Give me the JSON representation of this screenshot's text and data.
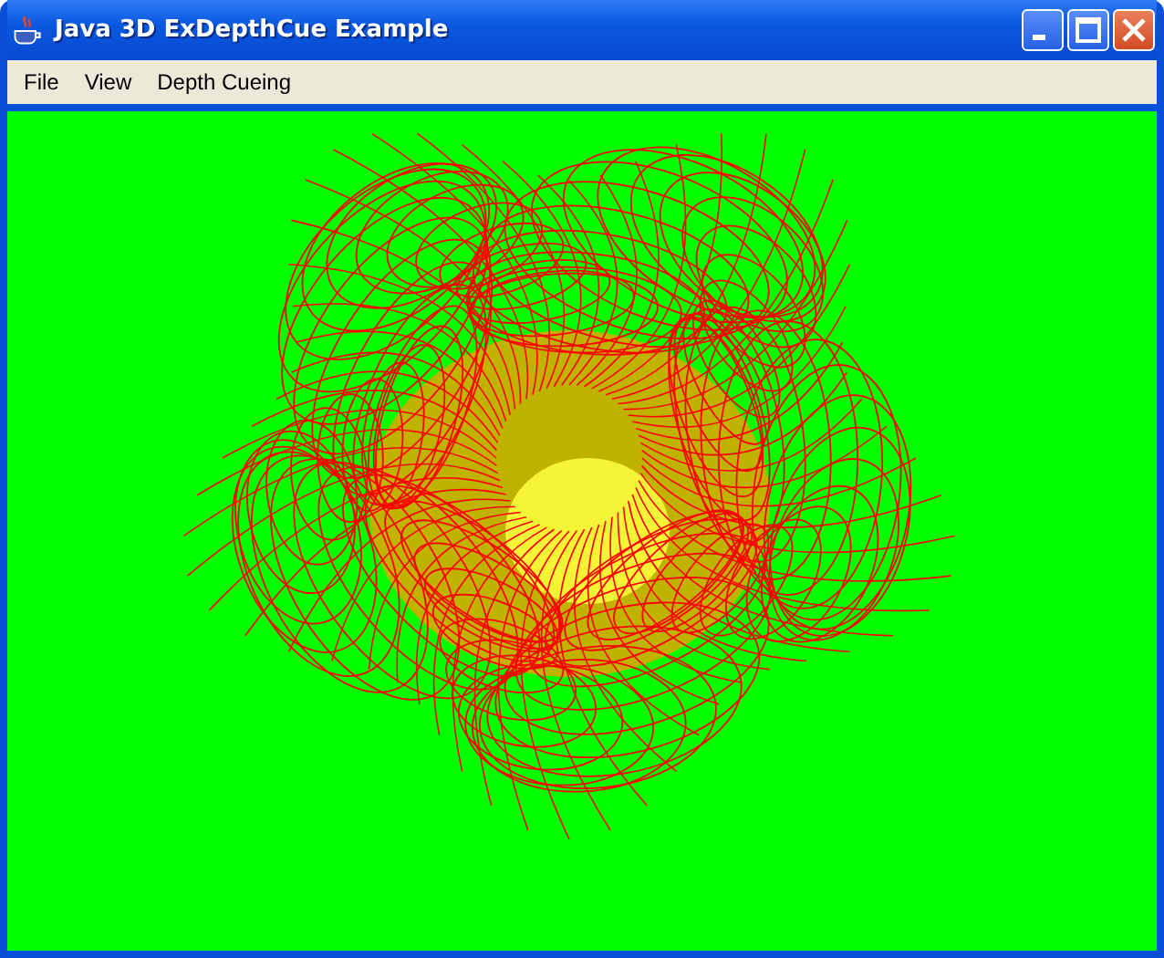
{
  "window": {
    "title": "Java 3D ExDepthCue Example"
  },
  "menu": [
    "File",
    "View",
    "Depth Cueing"
  ]
}
